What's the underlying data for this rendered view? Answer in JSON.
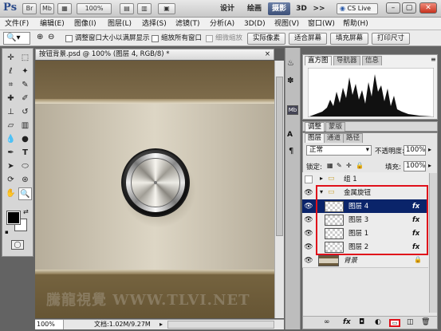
{
  "app": {
    "logo": "Ps",
    "br": "Br",
    "mb": "Mb",
    "zoom_box": "100%"
  },
  "workspaces": [
    "设计",
    "绘画",
    "摄影",
    "3D",
    ">>"
  ],
  "active_workspace_index": 2,
  "cs_live": "CS Live",
  "menu": [
    "文件(F)",
    "编辑(E)",
    "图像(I)",
    "图层(L)",
    "选择(S)",
    "滤镜(T)",
    "分析(A)",
    "3D(D)",
    "视图(V)",
    "窗口(W)",
    "帮助(H)"
  ],
  "options": {
    "resize_windows": "调整窗口大小以满屏显示",
    "zoom_all": "缩放所有窗口",
    "scrubby_zoom": "细微缩放",
    "actual_pixels": "实际像素",
    "fit_screen": "适合屏幕",
    "fill_screen": "填充屏幕",
    "print_size": "打印尺寸"
  },
  "document": {
    "tab_title": "按钮背景.psd @ 100% (图层 4, RGB/8) *",
    "watermark": "騰龍視覺 WWW.TLVI.NET",
    "status_zoom": "100%",
    "status_doc": "文档:1.02M/9.27M"
  },
  "panels": {
    "histogram_tabs": [
      "直方图",
      "导航器",
      "信息"
    ],
    "adjust_tabs": [
      "调整",
      "蒙版"
    ],
    "layers_tabs": [
      "图层",
      "通道",
      "路径"
    ],
    "blend_mode": "正常",
    "opacity_label": "不透明度:",
    "opacity_value": "100%",
    "lock_label": "锁定:",
    "fill_label": "填充:",
    "fill_value": "100%"
  },
  "layers": [
    {
      "name": "组 1",
      "type": "group-closed",
      "fx": ""
    },
    {
      "name": "金属旋钮",
      "type": "group-open",
      "fx": ""
    },
    {
      "name": "图层 4",
      "type": "layer",
      "fx": "fx",
      "selected": true
    },
    {
      "name": "图层 3",
      "type": "layer",
      "fx": "fx"
    },
    {
      "name": "图层 1",
      "type": "layer",
      "fx": "fx"
    },
    {
      "name": "图层 2",
      "type": "layer",
      "fx": "fx"
    },
    {
      "name": "背景",
      "type": "background",
      "fx": ""
    }
  ],
  "colors": {
    "highlight_box": "#e0101a",
    "selected_layer": "#0a246a",
    "knob_ring": "#222"
  }
}
